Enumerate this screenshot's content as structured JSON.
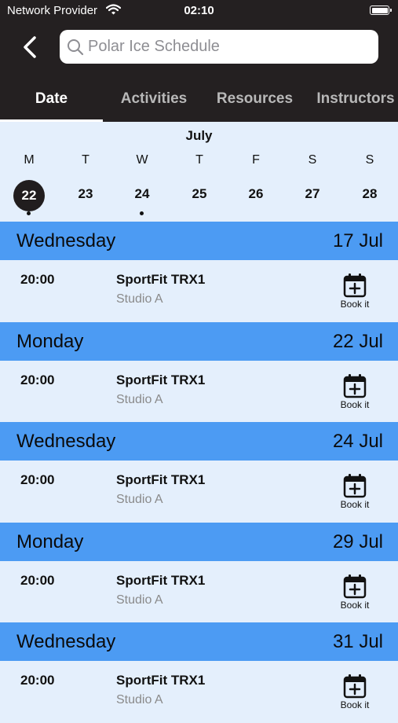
{
  "status_bar": {
    "provider": "Network Provider",
    "time": "02:10",
    "icons": [
      "wifi-icon",
      "battery-icon"
    ]
  },
  "header": {
    "back_icon": "chevron-left-icon",
    "search": {
      "icon": "search-icon",
      "placeholder": "Polar Ice Schedule",
      "value": ""
    }
  },
  "tabs": [
    {
      "label": "Date",
      "active": true
    },
    {
      "label": "Activities",
      "active": false
    },
    {
      "label": "Resources",
      "active": false
    },
    {
      "label": "Instructors",
      "active": false
    }
  ],
  "calendar": {
    "month": "July",
    "weekdays": [
      "M",
      "T",
      "W",
      "T",
      "F",
      "S",
      "S"
    ],
    "days": [
      {
        "num": "22",
        "selected": true,
        "has_event": true
      },
      {
        "num": "23",
        "selected": false,
        "has_event": false
      },
      {
        "num": "24",
        "selected": false,
        "has_event": true
      },
      {
        "num": "25",
        "selected": false,
        "has_event": false
      },
      {
        "num": "26",
        "selected": false,
        "has_event": false
      },
      {
        "num": "27",
        "selected": false,
        "has_event": false
      },
      {
        "num": "28",
        "selected": false,
        "has_event": false
      }
    ]
  },
  "schedule": [
    {
      "day": "Wednesday",
      "date": "17 Jul",
      "time": "20:00",
      "activity": "SportFit TRX1",
      "room": "Studio A",
      "book_label": "Book it"
    },
    {
      "day": "Monday",
      "date": "22 Jul",
      "time": "20:00",
      "activity": "SportFit TRX1",
      "room": "Studio A",
      "book_label": "Book it"
    },
    {
      "day": "Wednesday",
      "date": "24 Jul",
      "time": "20:00",
      "activity": "SportFit TRX1",
      "room": "Studio A",
      "book_label": "Book it"
    },
    {
      "day": "Monday",
      "date": "29 Jul",
      "time": "20:00",
      "activity": "SportFit TRX1",
      "room": "Studio A",
      "book_label": "Book it"
    },
    {
      "day": "Wednesday",
      "date": "31 Jul",
      "time": "20:00",
      "activity": "SportFit TRX1",
      "room": "Studio A",
      "book_label": "Book it"
    }
  ],
  "colors": {
    "topbar": "#242021",
    "section_header": "#4c9bf3",
    "background": "#e4effc",
    "selected_day": "#211d1e"
  }
}
